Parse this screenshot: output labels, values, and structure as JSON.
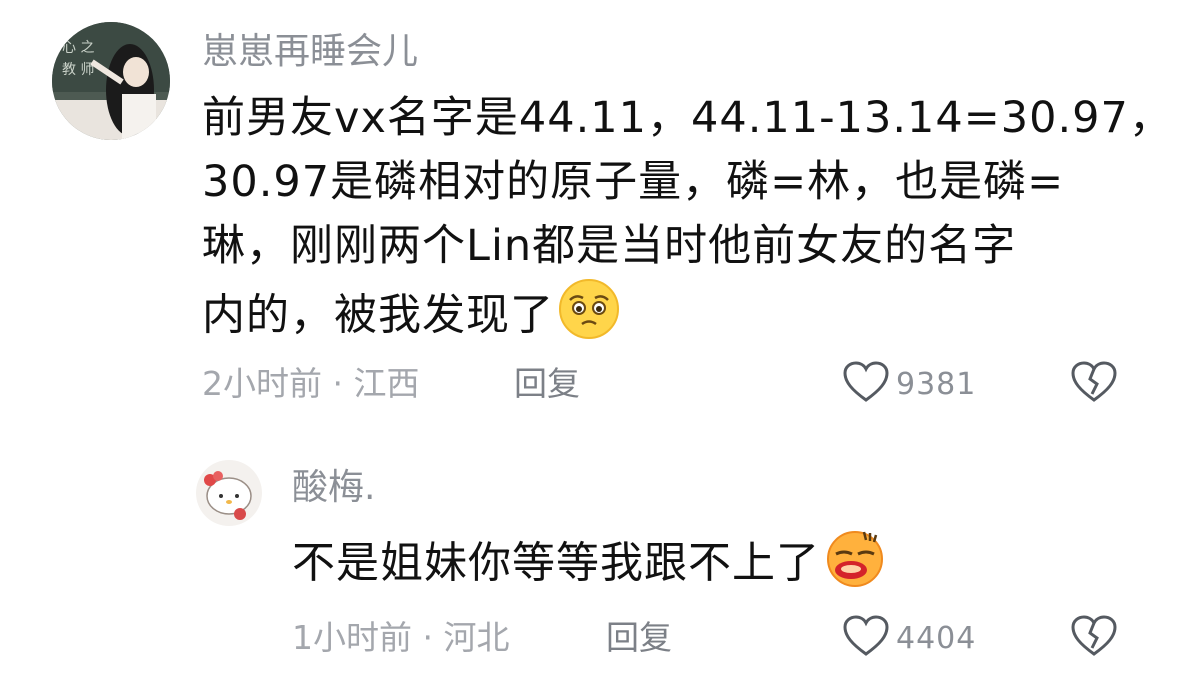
{
  "comments": [
    {
      "username": "崽崽再睡会儿",
      "lines": [
        "前男友vx名字是44.11，44.11-13.14=30.97，",
        "30.97是磷相对的原子量，磷=林，也是磷=",
        "琳，刚刚两个Lin都是当时他前女友的名字",
        "内的，被我发现了"
      ],
      "emoji": "pleading-face-emoji",
      "meta": "2小时前 · 江西",
      "reply_label": "回复",
      "likes": "9381"
    },
    {
      "username": "酸梅.",
      "lines": [
        "不是姐妹你等等我跟不上了"
      ],
      "emoji": "scream-face-emoji",
      "meta": "1小时前 · 河北",
      "reply_label": "回复",
      "likes": "4404"
    }
  ],
  "icons": {
    "like": "heart-outline-icon",
    "dislike": "broken-heart-icon"
  },
  "colors": {
    "username": "#8b8f96",
    "meta": "#a4a7ad",
    "text": "#111111"
  }
}
